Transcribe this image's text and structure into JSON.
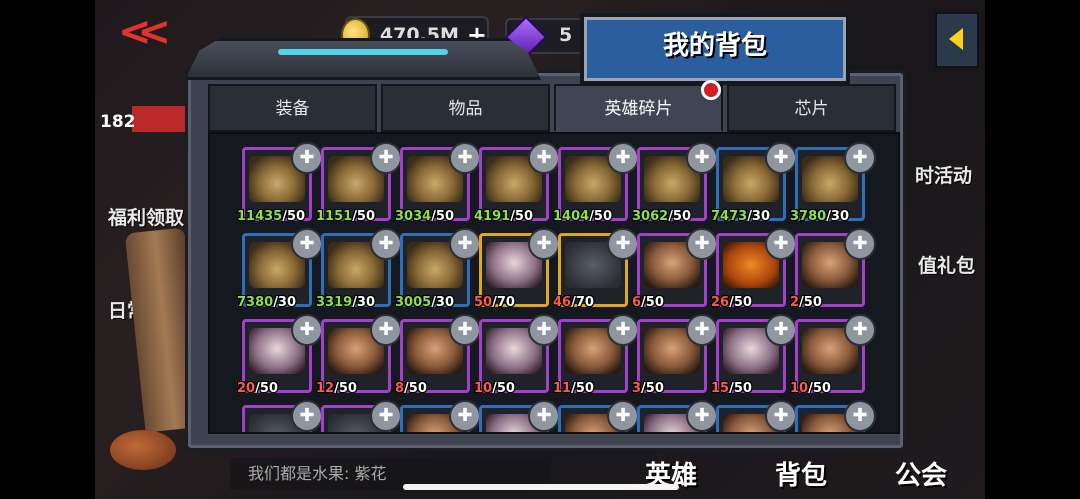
{
  "hud": {
    "gold": "470.5M",
    "gems": "5"
  },
  "background": {
    "level": "182",
    "left_labels": [
      "福利领取",
      "日常任"
    ],
    "right_labels": [
      "时活动",
      "值礼包"
    ]
  },
  "panel": {
    "title": "我的背包",
    "tabs": [
      {
        "label": "装备",
        "active": false
      },
      {
        "label": "物品",
        "active": false
      },
      {
        "label": "英雄碎片",
        "active": true
      },
      {
        "label": "芯片",
        "active": false
      }
    ],
    "fragments": [
      {
        "have": "11435",
        "need": "/50",
        "frame": "purple",
        "art": "mech",
        "enough": true
      },
      {
        "have": "1151",
        "need": "/50",
        "frame": "purple",
        "art": "mech",
        "enough": true
      },
      {
        "have": "3034",
        "need": "/50",
        "frame": "purple",
        "art": "mech",
        "enough": true
      },
      {
        "have": "4191",
        "need": "/50",
        "frame": "purple",
        "art": "mech",
        "enough": true
      },
      {
        "have": "1404",
        "need": "/50",
        "frame": "purple",
        "art": "mech",
        "enough": true
      },
      {
        "have": "3062",
        "need": "/50",
        "frame": "purple",
        "art": "mech",
        "enough": true
      },
      {
        "have": "7473",
        "need": "/30",
        "frame": "blue",
        "art": "mech",
        "enough": true
      },
      {
        "have": "3780",
        "need": "/30",
        "frame": "blue",
        "art": "mech",
        "enough": true
      },
      {
        "have": "7380",
        "need": "/30",
        "frame": "blue",
        "art": "mech",
        "enough": true
      },
      {
        "have": "3319",
        "need": "/30",
        "frame": "blue",
        "art": "mech",
        "enough": true
      },
      {
        "have": "3005",
        "need": "/30",
        "frame": "blue",
        "art": "mech",
        "enough": true
      },
      {
        "have": "50",
        "need": "/70",
        "frame": "gold",
        "art": "pale",
        "enough": false
      },
      {
        "have": "46",
        "need": "/70",
        "frame": "gold",
        "art": "ghost",
        "enough": false
      },
      {
        "have": "6",
        "need": "/50",
        "frame": "purple",
        "art": "person",
        "enough": false
      },
      {
        "have": "26",
        "need": "/50",
        "frame": "purple",
        "art": "pumpkin",
        "enough": false
      },
      {
        "have": "2",
        "need": "/50",
        "frame": "purple",
        "art": "person",
        "enough": false
      },
      {
        "have": "20",
        "need": "/50",
        "frame": "purple",
        "art": "pale",
        "enough": false
      },
      {
        "have": "12",
        "need": "/50",
        "frame": "purple",
        "art": "person",
        "enough": false
      },
      {
        "have": "8",
        "need": "/50",
        "frame": "purple",
        "art": "person",
        "enough": false
      },
      {
        "have": "10",
        "need": "/50",
        "frame": "purple",
        "art": "pale",
        "enough": false
      },
      {
        "have": "11",
        "need": "/50",
        "frame": "purple",
        "art": "person",
        "enough": false
      },
      {
        "have": "3",
        "need": "/50",
        "frame": "purple",
        "art": "person",
        "enough": false
      },
      {
        "have": "15",
        "need": "/50",
        "frame": "purple",
        "art": "pale",
        "enough": false
      },
      {
        "have": "10",
        "need": "/50",
        "frame": "purple",
        "art": "person",
        "enough": false
      },
      {
        "have": "",
        "need": "",
        "frame": "purple",
        "art": "ghost",
        "enough": false
      },
      {
        "have": "",
        "need": "",
        "frame": "purple",
        "art": "ghost",
        "enough": false
      },
      {
        "have": "",
        "need": "",
        "frame": "blue",
        "art": "person",
        "enough": false
      },
      {
        "have": "",
        "need": "",
        "frame": "blue",
        "art": "pale",
        "enough": false
      },
      {
        "have": "",
        "need": "",
        "frame": "blue",
        "art": "person",
        "enough": false
      },
      {
        "have": "",
        "need": "",
        "frame": "blue",
        "art": "pale",
        "enough": false
      },
      {
        "have": "",
        "need": "",
        "frame": "blue",
        "art": "person",
        "enough": false
      },
      {
        "have": "",
        "need": "",
        "frame": "blue",
        "art": "person",
        "enough": false
      }
    ]
  },
  "chat": {
    "text": "我们都是水果: 紫花"
  },
  "bottom_nav": [
    "英雄",
    "背包",
    "公会"
  ]
}
